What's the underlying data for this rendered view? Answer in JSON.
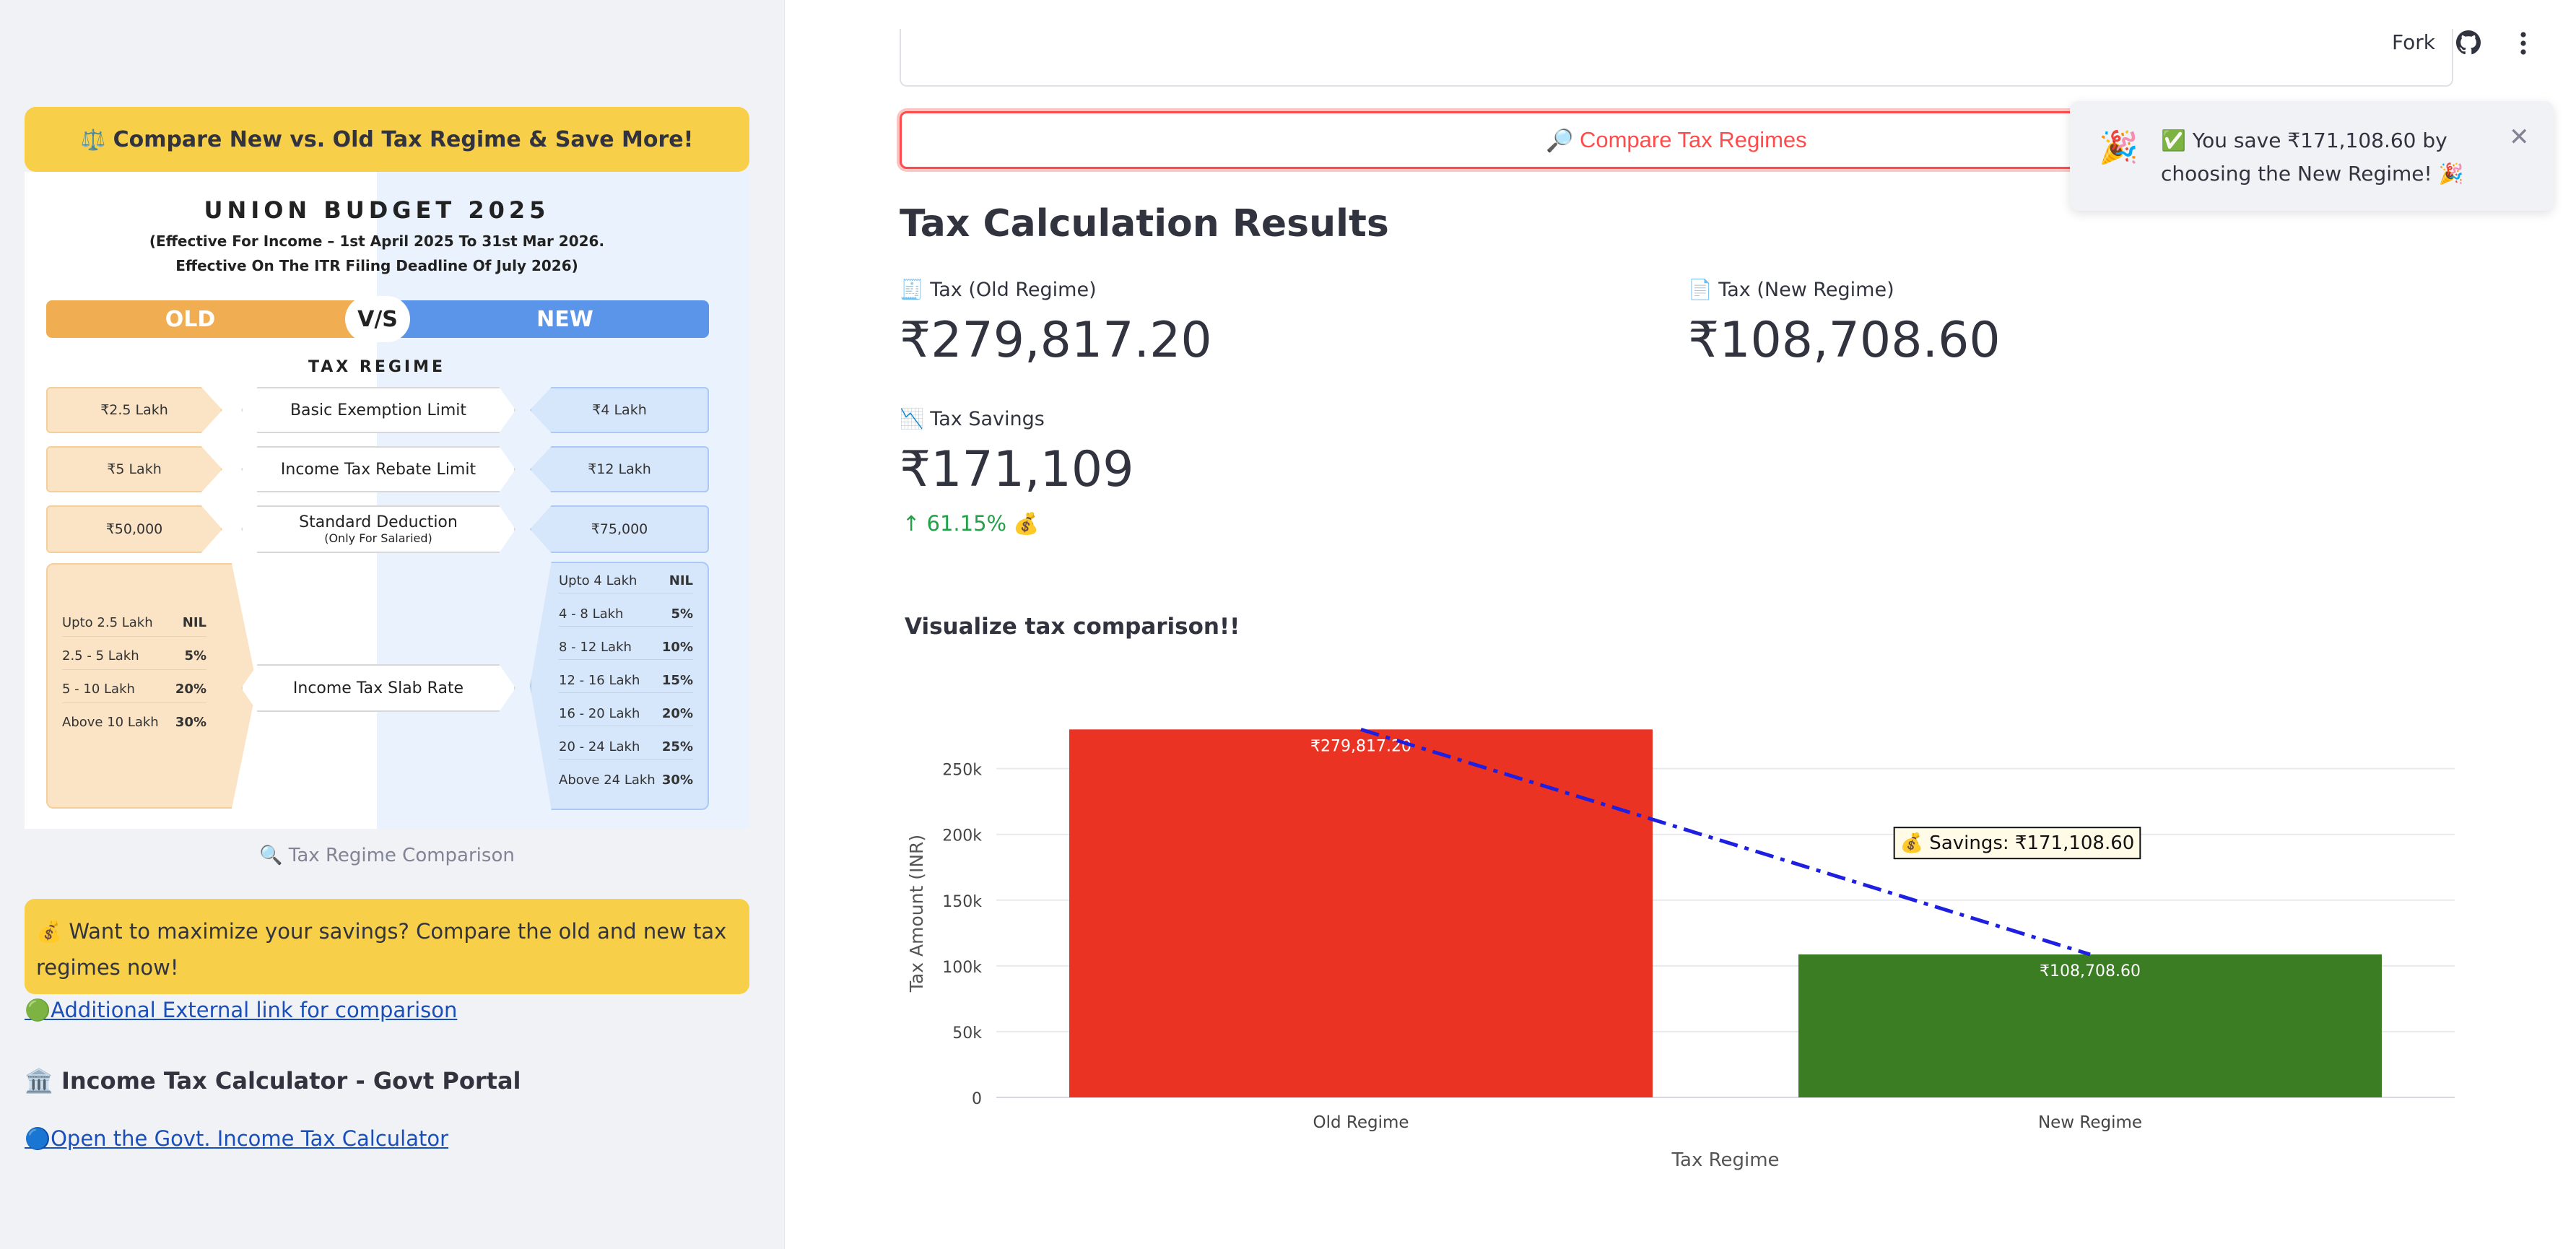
{
  "header": {
    "fork_label": "Fork",
    "github_icon": "github-icon",
    "menu_icon": "kebab-menu-icon"
  },
  "sidebar": {
    "banner": {
      "icon": "⚖️",
      "text": "Compare New vs. Old Tax Regime & Save More!"
    },
    "infographic": {
      "title": "UNION BUDGET 2025",
      "subtitle_1": "(Effective For Income – 1st April 2025 To 31st Mar 2026.",
      "subtitle_2": "Effective On The ITR Filing Deadline Of July 2026)",
      "old_label": "OLD",
      "vs_label": "V/S",
      "new_label": "NEW",
      "regime_label": "TAX REGIME",
      "rows": [
        {
          "old": "₹2.5 Lakh",
          "mid": "Basic Exemption Limit",
          "mid_sub": "",
          "new": "₹4 Lakh"
        },
        {
          "old": "₹5 Lakh",
          "mid": "Income Tax Rebate Limit",
          "mid_sub": "",
          "new": "₹12 Lakh"
        },
        {
          "old": "₹50,000",
          "mid": "Standard Deduction",
          "mid_sub": "(Only For Salaried)",
          "new": "₹75,000"
        }
      ],
      "slab_label": "Income Tax Slab Rate",
      "old_slabs": [
        {
          "range": "Upto 2.5 Lakh",
          "rate": "NIL"
        },
        {
          "range": "2.5 - 5 Lakh",
          "rate": "5%"
        },
        {
          "range": "5 - 10 Lakh",
          "rate": "20%"
        },
        {
          "range": "Above 10 Lakh",
          "rate": "30%"
        }
      ],
      "new_slabs": [
        {
          "range": "Upto 4 Lakh",
          "rate": "NIL"
        },
        {
          "range": "4 - 8 Lakh",
          "rate": "5%"
        },
        {
          "range": "8 - 12 Lakh",
          "rate": "10%"
        },
        {
          "range": "12 - 16 Lakh",
          "rate": "15%"
        },
        {
          "range": "16 - 20 Lakh",
          "rate": "20%"
        },
        {
          "range": "20 - 24 Lakh",
          "rate": "25%"
        },
        {
          "range": "Above 24 Lakh",
          "rate": "30%"
        }
      ]
    },
    "caption": {
      "icon": "🔍",
      "text": "Tax Regime Comparison"
    },
    "info_box": {
      "icon": "💰",
      "text": "Want to maximize your savings? Compare the old and new tax regimes now!"
    },
    "external_link": {
      "icon": "🟢",
      "text": "Additional External link for comparison"
    },
    "govt_heading": {
      "icon": "🏛️",
      "text": "Income Tax Calculator - Govt Portal"
    },
    "govt_link": {
      "icon": "🔵",
      "text": "Open the Govt. Income Tax Calculator"
    }
  },
  "main": {
    "compare_button": {
      "icon": "🔎",
      "text": "Compare Tax Regimes"
    },
    "results_title": "Tax Calculation Results",
    "metrics": {
      "old": {
        "icon": "🧾",
        "label": "Tax (Old Regime)",
        "value": "₹279,817.20"
      },
      "new": {
        "icon": "📄",
        "label": "Tax (New Regime)",
        "value": "₹108,708.60"
      },
      "savings": {
        "icon": "📉",
        "label": "Tax Savings",
        "value": "₹171,109",
        "delta_arrow": "↑",
        "delta": "61.15% 💰"
      }
    },
    "viz_title": "Visualize tax comparison!!"
  },
  "toast": {
    "icon": "🎉",
    "text": "✅ You save ₹171,108.60 by choosing the New Regime! 🎉",
    "close": "✕"
  },
  "colors": {
    "old_bar": "#ea3323",
    "new_bar": "#3a7d23",
    "savings_line": "#1f1fe0",
    "accent": "#ff4b4b"
  },
  "chart_data": {
    "type": "bar",
    "categories": [
      "Old Regime",
      "New Regime"
    ],
    "values": [
      279817.2,
      108708.6
    ],
    "data_labels": [
      "₹279,817.20",
      "₹108,708.60"
    ],
    "bar_colors": [
      "#ea3323",
      "#3a7d23"
    ],
    "xlabel": "Tax Regime",
    "ylabel": "Tax Amount (INR)",
    "ylim": [
      0,
      280000
    ],
    "yticks": [
      0,
      50000,
      100000,
      150000,
      200000,
      250000
    ],
    "ytick_labels": [
      "0",
      "50k",
      "100k",
      "150k",
      "200k",
      "250k"
    ],
    "overlay_line": {
      "style": "dash-dot",
      "from": "Old Regime",
      "to": "New Regime",
      "values": [
        279817.2,
        108708.6
      ]
    },
    "annotation": "💰 Savings: ₹171,108.60",
    "grid": true,
    "legend": "none"
  }
}
